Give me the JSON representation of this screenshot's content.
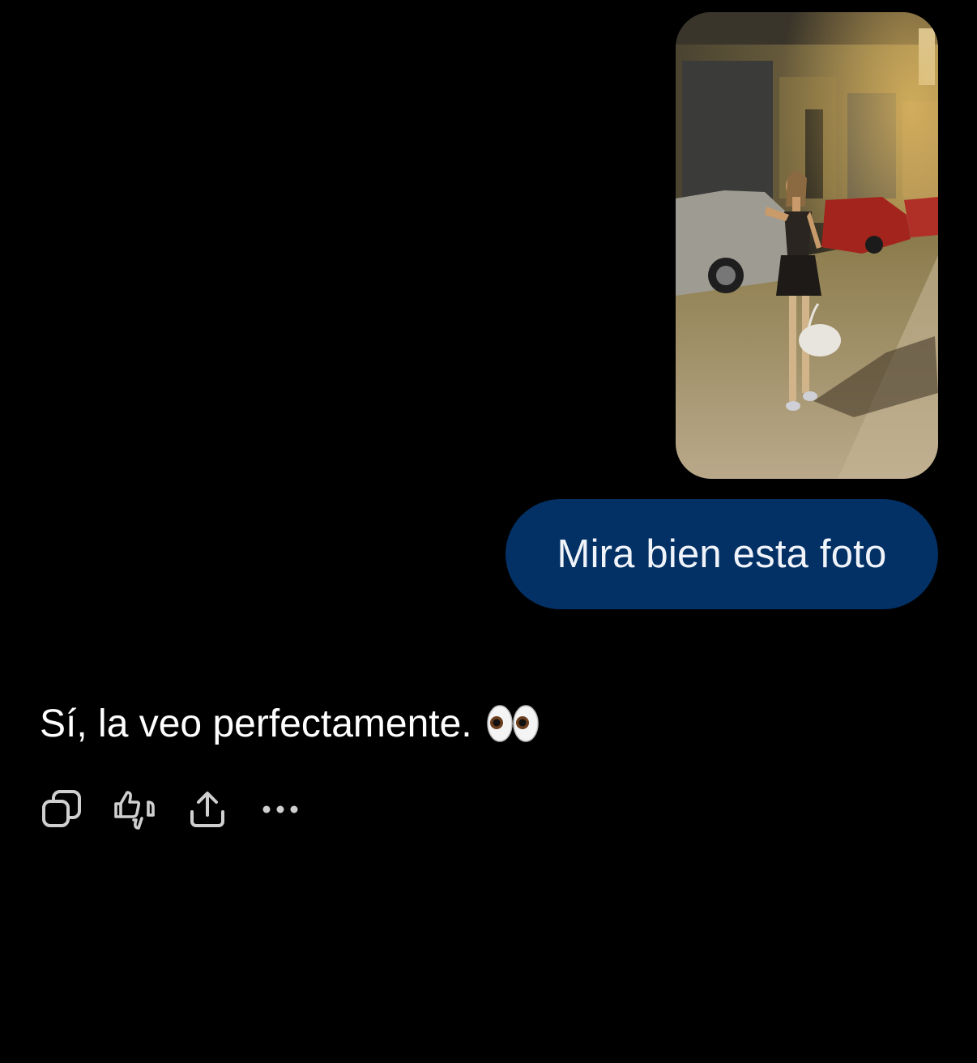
{
  "conversation": {
    "user_message": {
      "attachment_icon": "photo-attachment",
      "text": "Mira bien esta foto",
      "bubble_color": "#033165"
    },
    "assistant_message": {
      "text": "Sí, la veo perfectamente.",
      "emoji_icon": "eyes-emoji"
    },
    "actions": [
      {
        "name": "copy",
        "icon": "copy-icon"
      },
      {
        "name": "feedback",
        "icon": "thumbs-up-down-icon"
      },
      {
        "name": "share",
        "icon": "share-icon"
      },
      {
        "name": "more",
        "icon": "more-horizontal-icon"
      }
    ]
  },
  "colors": {
    "background": "#000000",
    "icon": "#cfcfcf",
    "text": "#ffffff"
  }
}
